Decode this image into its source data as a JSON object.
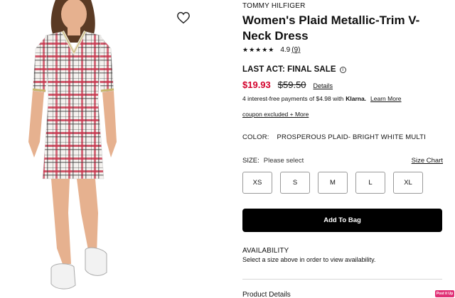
{
  "brand": "TOMMY HILFIGER",
  "title": "Women's Plaid Metallic-Trim V-Neck Dress",
  "rating": {
    "stars": "★★★★★",
    "value": "4.9",
    "count": "(9)"
  },
  "sale_label": "LAST ACT: FINAL SALE",
  "price": {
    "sale": "$19.93",
    "original": "$59.50",
    "details_link": "Details"
  },
  "klarna": {
    "text": "4 interest-free payments of $4.98 with",
    "logo": "Klarna.",
    "link": "Learn More"
  },
  "coupon": "coupon excluded + More",
  "color": {
    "label": "COLOR:",
    "value": "PROSPEROUS PLAID- BRIGHT WHITE MULTI"
  },
  "size": {
    "label": "SIZE:",
    "selected": "Please select",
    "chart_link": "Size Chart",
    "options": [
      "XS",
      "S",
      "M",
      "L",
      "XL"
    ]
  },
  "add_to_bag": "Add To Bag",
  "availability": {
    "title": "AVAILABILITY",
    "desc": "Select a size above in order to view availability."
  },
  "product_details": "Product Details",
  "pin_badge": "Post it Up",
  "colors": {
    "sale_red": "#d3002b",
    "black": "#000000",
    "badge_pink": "#e02f75"
  },
  "icons": {
    "wishlist": "heart-icon",
    "info": "info-icon"
  }
}
